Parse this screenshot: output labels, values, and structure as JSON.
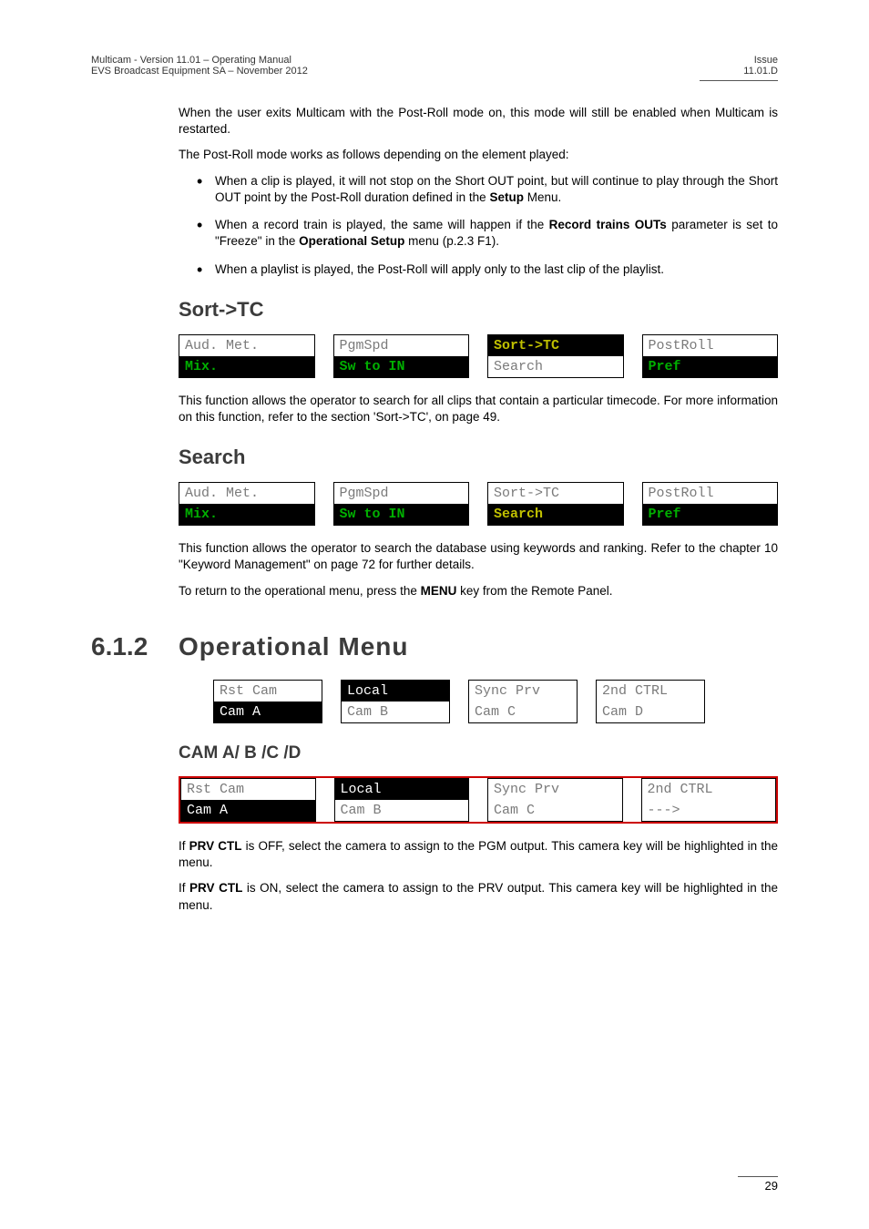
{
  "header": {
    "left_line1": "Multicam - Version 11.01 – Operating Manual",
    "left_line2": "EVS Broadcast Equipment SA – November 2012",
    "right_line1": "Issue",
    "right_line2": "11.01.D"
  },
  "intro": {
    "para1_a": "When the user exits Multicam with the Post-Roll mode on, this mode will still be enabled when Multicam is restarted.",
    "para2": "The Post-Roll mode works as follows depending on the element played:",
    "bullet1_a": "When a clip is played, it will not stop on the Short OUT point, but will continue to play through the Short OUT point by the Post-Roll duration defined in the ",
    "bullet1_b": "Setup",
    "bullet1_c": " Menu.",
    "bullet2_a": "When a record train is played, the same will happen if the ",
    "bullet2_b": "Record trains OUTs",
    "bullet2_c": " parameter is set to \"Freeze\" in the ",
    "bullet2_d": "Operational Setup",
    "bullet2_e": " menu (p.2.3 F1).",
    "bullet3": "When a playlist is played, the Post-Roll will apply only to the last clip of the playlist."
  },
  "sorttc": {
    "heading": "Sort->TC",
    "menu": {
      "c1_top": "Aud. Met.",
      "c1_bot": "Mix.",
      "c2_top": "PgmSpd",
      "c2_bot": "Sw to IN",
      "c3_top": "Sort->TC",
      "c3_bot": "Search",
      "c4_top": "PostRoll",
      "c4_bot": "Pref"
    },
    "para": "This function allows the operator to search for all clips that contain a particular timecode. For more information on this function, refer to the section 'Sort->TC', on page 49."
  },
  "search": {
    "heading": "Search",
    "menu": {
      "c1_top": "Aud. Met.",
      "c1_bot": "Mix.",
      "c2_top": "PgmSpd",
      "c2_bot": "Sw to IN",
      "c3_top": "Sort->TC",
      "c3_bot": "Search",
      "c4_top": "PostRoll",
      "c4_bot": "Pref"
    },
    "para1": "This function allows the operator to search the database using keywords and ranking. Refer to the chapter 10 \"Keyword Management\" on page 72 for further details.",
    "para2_a": "To return to the operational menu, press the ",
    "para2_b": "MENU",
    "para2_c": " key from the Remote Panel."
  },
  "opmenu": {
    "number": "6.1.2",
    "title": "Operational  Menu",
    "menu": {
      "c1_top": "Rst Cam",
      "c1_bot": "Cam A",
      "c2_top": "Local",
      "c2_bot": "Cam B",
      "c3_top": "Sync Prv",
      "c3_bot": "Cam C",
      "c4_top": "2nd CTRL",
      "c4_bot": "Cam D"
    }
  },
  "cam": {
    "heading": "CAM  A/  B  /C  /D",
    "menu": {
      "c1_top": "Rst Cam",
      "c1_bot": "Cam A",
      "c2_top": "Local",
      "c2_bot": "Cam B",
      "c3_top": "Sync Prv",
      "c3_bot": "Cam C",
      "c4_top": "2nd CTRL",
      "c4_bot": "--->"
    },
    "para1_a": "If ",
    "para1_b": "PRV CTL",
    "para1_c": " is OFF, select the camera to assign to the PGM output. This camera key will be highlighted in the menu.",
    "para2_a": "If ",
    "para2_b": "PRV CTL",
    "para2_c": " is ON, select the camera to assign to the PRV output. This camera key will be highlighted in the menu."
  },
  "footer": {
    "page": "29"
  }
}
